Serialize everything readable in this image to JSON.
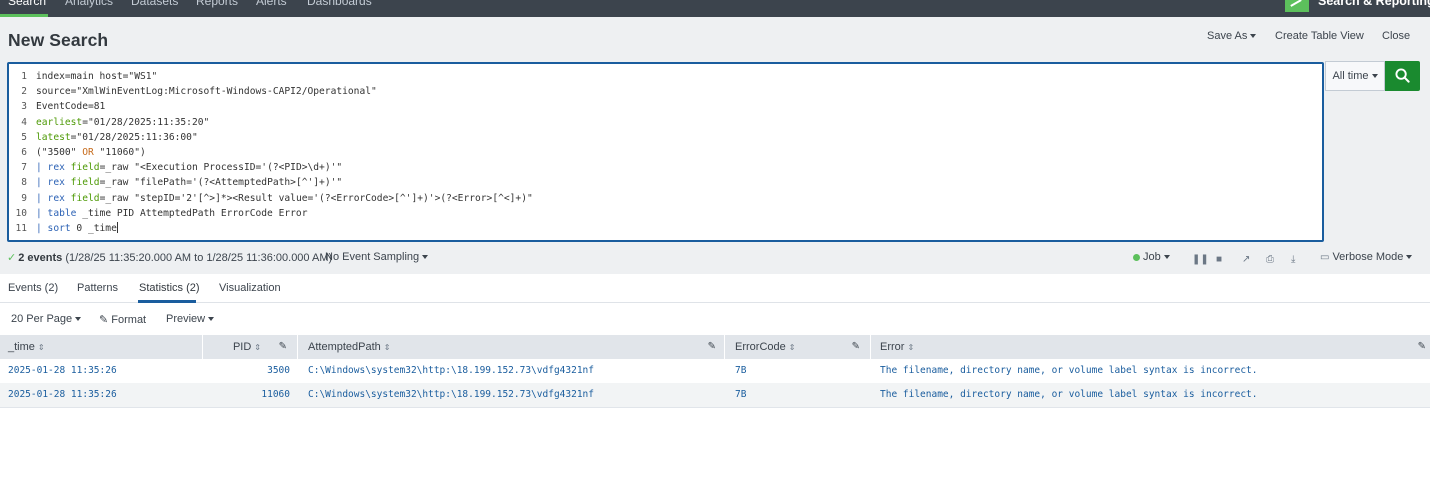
{
  "nav": {
    "items": [
      "Search",
      "Analytics",
      "Datasets",
      "Reports",
      "Alerts",
      "Dashboards"
    ],
    "app_name": "Search & Reporting"
  },
  "header": {
    "title": "New Search",
    "save_as": "Save As",
    "create_table_view": "Create Table View",
    "close": "Close"
  },
  "search": {
    "line_numbers": [
      "1",
      "2",
      "3",
      "4",
      "5",
      "6",
      "7",
      "8",
      "9",
      "10",
      "11"
    ],
    "time_picker": "All time"
  },
  "status": {
    "events": "2 events",
    "range": "(1/28/25 11:35:20.000 AM to 1/28/25 11:36:00.000 AM)",
    "sampling": "No Event Sampling",
    "job": "Job",
    "mode": "Verbose Mode"
  },
  "tabs": [
    "Events (2)",
    "Patterns",
    "Statistics (2)",
    "Visualization"
  ],
  "toolbar": {
    "per_page": "20 Per Page",
    "format": "Format",
    "preview": "Preview"
  },
  "table": {
    "columns": [
      "_time",
      "PID",
      "AttemptedPath",
      "ErrorCode",
      "Error"
    ],
    "rows": [
      [
        "2025-01-28 11:35:26",
        "3500",
        "C:\\Windows\\system32\\http:\\18.199.152.73\\vdfg4321nf",
        "7B",
        "The filename, directory name, or volume label syntax is incorrect."
      ],
      [
        "2025-01-28 11:35:26",
        "11060",
        "C:\\Windows\\system32\\http:\\18.199.152.73\\vdfg4321nf",
        "7B",
        "The filename, directory name, or volume label syntax is incorrect."
      ]
    ]
  },
  "colors": {
    "nav_bg": "#3c444d",
    "accent_green": "#5cc05c",
    "search_button": "#1a8a2f",
    "editor_border": "#1a5d9e",
    "link_blue": "#1a5d9e"
  }
}
